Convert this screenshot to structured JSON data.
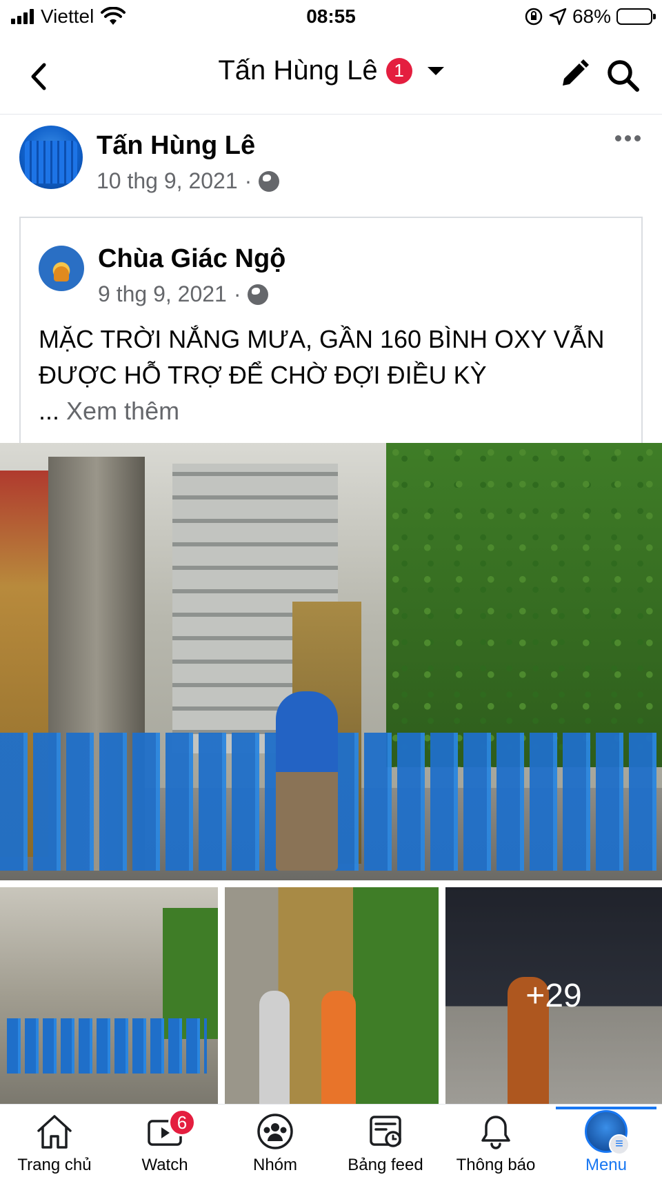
{
  "status_bar": {
    "carrier": "Viettel",
    "time": "08:55",
    "battery": "68%",
    "battery_level": 0.68
  },
  "nav": {
    "title": "Tấn Hùng Lê",
    "badge": "1"
  },
  "post": {
    "author": "Tấn Hùng Lê",
    "date": "10 thg 9, 2021",
    "separator": "·"
  },
  "shared": {
    "author": "Chùa Giác Ngộ",
    "date": "9 thg 9, 2021",
    "separator": "·",
    "text": "MẶC TRỜI NẮNG MƯA, GẦN 160 BÌNH OXY VẪN ĐƯỢC HỖ TRỢ ĐỂ CHỜ ĐỢI ĐIỀU KỲ",
    "ellipsis": "...",
    "see_more": "Xem thêm"
  },
  "photos": {
    "more_count": "+29"
  },
  "tabs": [
    {
      "label": "Trang chủ",
      "icon": "home-icon"
    },
    {
      "label": "Watch",
      "icon": "watch-icon",
      "badge": "6"
    },
    {
      "label": "Nhóm",
      "icon": "groups-icon"
    },
    {
      "label": "Bảng feed",
      "icon": "feed-icon"
    },
    {
      "label": "Thông báo",
      "icon": "bell-icon"
    },
    {
      "label": "Menu",
      "icon": "menu-avatar",
      "active": true
    }
  ],
  "colors": {
    "accent": "#1877f2",
    "badge": "#e41e3f",
    "secondary_text": "#65676b"
  }
}
